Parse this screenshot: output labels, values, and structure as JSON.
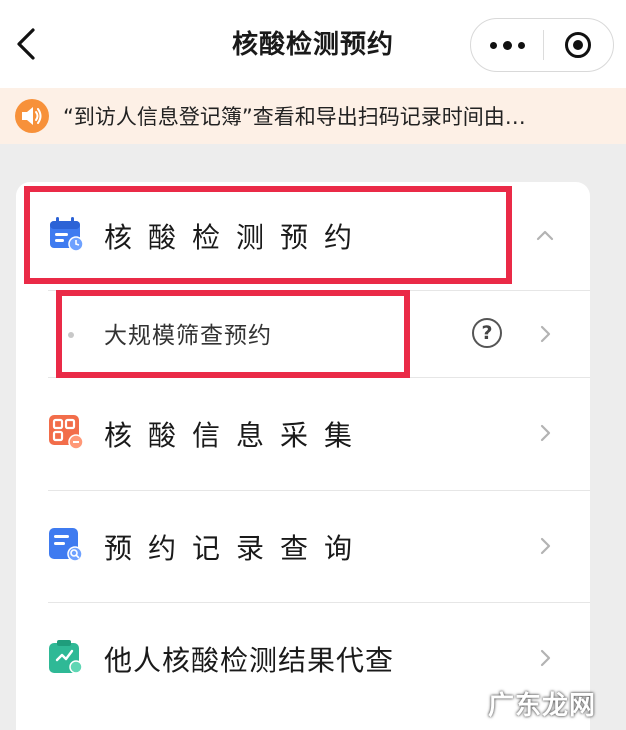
{
  "nav": {
    "title": "核酸检测预约",
    "back_icon": "chevron-left-icon",
    "more_icon": "more-dots-icon",
    "close_icon": "record-circle-icon"
  },
  "notice": {
    "icon": "speaker-icon",
    "text": "“到访人信息登记簿”查看和导出扫码记录时间由…",
    "color": "#f7913a"
  },
  "menu": {
    "items": [
      {
        "label": "核酸检测预约",
        "icon": "calendar-icon",
        "state": "expanded",
        "color": "#3f7bf0"
      },
      {
        "label": "大规模筛查预约",
        "sub": true,
        "help_icon": "question-icon"
      },
      {
        "label": "核酸信息采集",
        "icon": "qr-grid-icon",
        "color": "#f26d4a"
      },
      {
        "label": "预约记录查询",
        "icon": "document-search-icon",
        "color": "#3f7bf0"
      },
      {
        "label": "他人核酸检测结果代查",
        "icon": "clipboard-check-icon",
        "color": "#2fb996"
      }
    ]
  },
  "help": {
    "glyph": "?"
  },
  "annotation": {
    "highlight_color": "#ea2a47"
  },
  "watermark": "广东龙网"
}
